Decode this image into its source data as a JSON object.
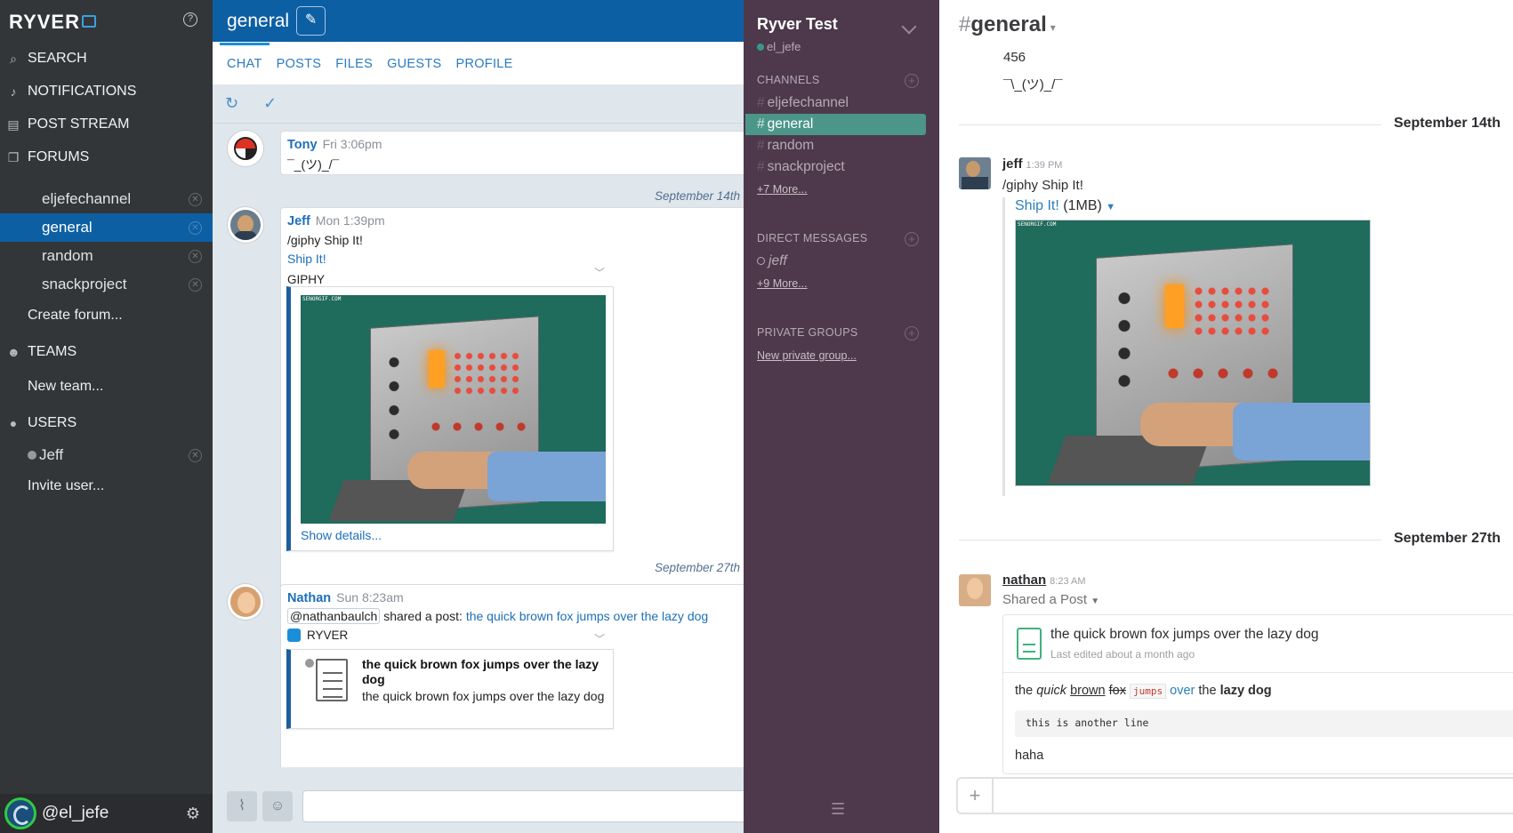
{
  "ryver": {
    "logo": "RYVER",
    "nav": {
      "search": "SEARCH",
      "notifications": "NOTIFICATIONS",
      "post_stream": "POST STREAM",
      "forums": "FORUMS",
      "teams": "TEAMS",
      "users": "USERS"
    },
    "forums": [
      "eljefechannel",
      "general",
      "random",
      "snackproject"
    ],
    "create_forum": "Create forum...",
    "new_team": "New team...",
    "users": [
      "Jeff"
    ],
    "invite_user": "Invite user...",
    "me": "@el_jefe",
    "channel_title": "general",
    "tabs": [
      "CHAT",
      "POSTS",
      "FILES",
      "GUESTS",
      "PROFILE"
    ],
    "messages": {
      "tony": {
        "name": "Tony",
        "time": "Fri 3:06pm",
        "text": "¯_(ツ)_/¯"
      },
      "date1": "September 14th",
      "jeff": {
        "name": "Jeff",
        "time": "Mon 1:39pm",
        "text": "/giphy Ship It!",
        "link": "Ship It!",
        "source": "GIPHY",
        "gif_watermark": "SENORGIF.COM",
        "details": "Show details..."
      },
      "date2": "September 27th",
      "nathan": {
        "name": "Nathan",
        "time": "Sun 8:23am",
        "mention": "@nathanbaulch",
        "shared": "shared a post:",
        "post_link": "the quick brown fox jumps over the lazy dog",
        "source": "RYVER",
        "post_title": "the quick brown fox jumps over the lazy dog",
        "post_body": "the quick brown fox jumps over the lazy dog"
      }
    }
  },
  "slack": {
    "team": "Ryver Test",
    "user": "el_jefe",
    "channels_header": "CHANNELS",
    "channels": [
      "eljefechannel",
      "general",
      "random",
      "snackproject"
    ],
    "channels_more": "+7 More...",
    "dm_header": "DIRECT MESSAGES",
    "dms": [
      "jeff"
    ],
    "dm_more": "+9 More...",
    "groups_header": "PRIVATE GROUPS",
    "new_group": "New private group...",
    "channel_title": "general",
    "lines": {
      "a": "456",
      "b": "¯\\_(ツ)_/¯"
    },
    "date1": "September 14th",
    "jeff": {
      "name": "jeff",
      "time": "1:39 PM",
      "text": "/giphy Ship It!",
      "file_link": "Ship It!",
      "file_size": "(1MB)",
      "gif_watermark": "SENORGIF.COM"
    },
    "date2": "September 27th",
    "nathan": {
      "name": "nathan",
      "time": "8:23 AM",
      "shared": "Shared a Post",
      "post_title": "the quick brown fox jumps over the lazy dog",
      "post_meta": "Last edited about a month ago",
      "rich": {
        "w1": "the",
        "w2": "quick",
        "w3": "brown",
        "w4": "fox",
        "w5": "jumps",
        "w6": "over",
        "w7": "the",
        "w8": "lazy dog"
      },
      "code_line": "this is another line",
      "last_line": "haha"
    }
  },
  "colors": {
    "ryver_blue": "#0d5fa3",
    "slack_aubergine": "#4d394b",
    "slack_active": "#4c9689"
  }
}
